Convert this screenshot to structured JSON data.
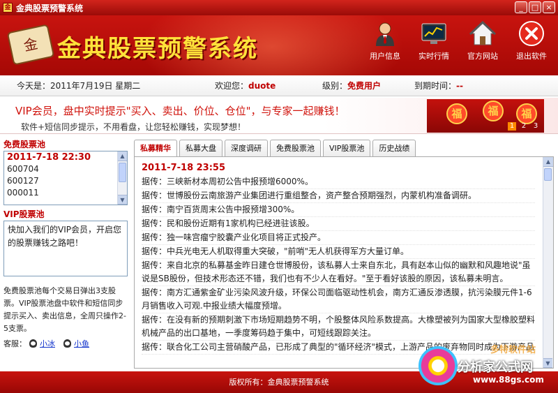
{
  "window": {
    "title": "金典股票预警系统",
    "controls": [
      "_",
      "□",
      "×"
    ]
  },
  "header": {
    "logo_glyph": "金",
    "logo_text": "金典股票预警系统",
    "nav": [
      {
        "label": "用户信息",
        "icon": "user-icon"
      },
      {
        "label": "实时行情",
        "icon": "monitor-chart-icon"
      },
      {
        "label": "官方网站",
        "icon": "home-icon"
      },
      {
        "label": "退出软件",
        "icon": "exit-icon"
      }
    ]
  },
  "info": {
    "today_label": "今天是：",
    "today_value": "2011年7月19日 星期二",
    "welcome_label": "欢迎您：",
    "username": "duote",
    "level_label": "级别：",
    "level_value": "免费用户",
    "expire_label": "到期时间：",
    "expire_value": "--"
  },
  "banner": {
    "line1": "VIP会员，盘中实时提示\"买入、卖出、价位、仓位\"，与专家一起赚钱！",
    "line2": "软件+短信同步提示，不用看盘，让您轻松赚钱，实现梦想！",
    "lantern_char": "福",
    "pages": [
      "1",
      "2",
      "3"
    ],
    "active_page": 1
  },
  "left": {
    "free_pool_title": "免费股票池",
    "free_pool_date": "2011-7-18 22:30",
    "free_pool_codes": [
      "600704",
      "600127",
      "000011"
    ],
    "vip_pool_title": "VIP股票池",
    "vip_pool_text": "快加入我们的VIP会员，开启您的股票赚钱之路吧！",
    "note": "免费股票池每个交易日弹出3支股票。VIP股票池盘中软件和短信同步提示买入、卖出信息，全周只操作2-5支票。",
    "kefu_label": "客服：",
    "kefu1": "小冰",
    "kefu2": "小鱼"
  },
  "main": {
    "tabs": [
      "私募精华",
      "私募大盘",
      "深度调研",
      "免费股票池",
      "VIP股票池",
      "历史战绩"
    ],
    "active_tab": 0,
    "date": "2011-7-18 23:55",
    "news": [
      "据传：三峡新材本周初公告中报预增6000%。",
      "据传：世博股份云南旅游产业集团进行重组整合，资产整合预期强烈，内蒙机构准备调研。",
      "据传：南宁百货周末公告中报预增300%。",
      "据传：民和股份近期有1家机构已经进驻该股。",
      "据传：独一味宫瘤宁胶囊产业化项目将正式投产。",
      "据传：中兵光电无人机取得重大突破，\"前哨\"无人机获得军方大量订单。",
      "据传：来自北京的私募基金昨日建仓世博股份，该私募人士来自东北，具有赵本山似的幽默和风趣地说\"虽说是SB股份，但技术形态还不错，我们也有不少人在看好。\"至于看好该股的原因，该私募未明言。",
      "据传：南方汇通紫金矿业污染风波升级，环保公司面临驱动性机会，南方汇通反渗透膜，抗污染膜元件1-6月销售收入可观.中报业绩大幅度预增。",
      "据传：在没有新的预期刺激下市场短期趋势不明，个股整体风险系数提高。大橡塑被列为国家大型橡胶塑料机械产品的出口基地，一季度筹码趋于集中，可短线跟踪关注。",
      "据传：联合化工公司主营硝酸产品，已形成了典型的\"循环经济\"模式，上游产品的废弃物同时成为下游产品"
    ]
  },
  "status": {
    "copyright": "版权所有：金典股票预警系统"
  },
  "brand": {
    "line0": "多特软件站",
    "line1": "分析家公式网",
    "line2": "www.88gs.com"
  },
  "colors": {
    "brand_red": "#c8140f",
    "accent_gold": "#ffe23a",
    "text_red": "#c00000"
  }
}
